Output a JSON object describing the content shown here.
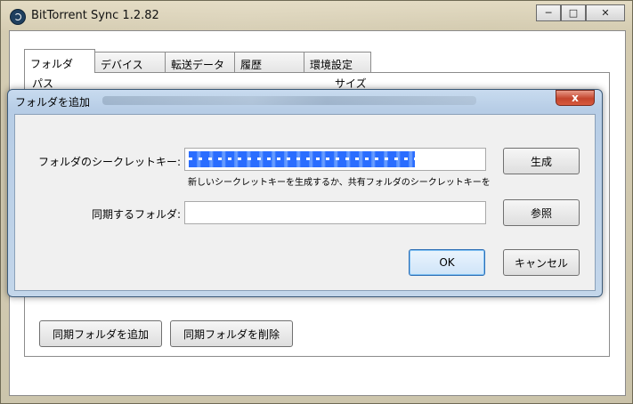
{
  "window": {
    "title": "BitTorrent Sync 1.2.82",
    "minimize_glyph": "─",
    "maximize_glyph": "□",
    "close_glyph": "✕"
  },
  "tabs": [
    {
      "label": "フォルダ",
      "active": true
    },
    {
      "label": "デバイス",
      "active": false
    },
    {
      "label": "転送データ",
      "active": false
    },
    {
      "label": "履歴",
      "active": false
    },
    {
      "label": "環境設定",
      "active": false
    }
  ],
  "table": {
    "columns": [
      "パス",
      "サイズ"
    ]
  },
  "bottom": {
    "add_button": "同期フォルダを追加",
    "remove_button": "同期フォルダを削除"
  },
  "dialog": {
    "title": "フォルダを追加",
    "close_glyph": "x",
    "secret_label": "フォルダのシークレットキー:",
    "secret_value": "",
    "generate_button": "生成",
    "hint": "新しいシークレットキーを生成するか、共有フォルダのシークレットキーを",
    "folder_label": "同期するフォルダ:",
    "folder_value": "",
    "browse_button": "参照",
    "ok_button": "OK",
    "cancel_button": "キャンセル"
  },
  "icons": {
    "app": "bittorrent-sync-icon"
  }
}
